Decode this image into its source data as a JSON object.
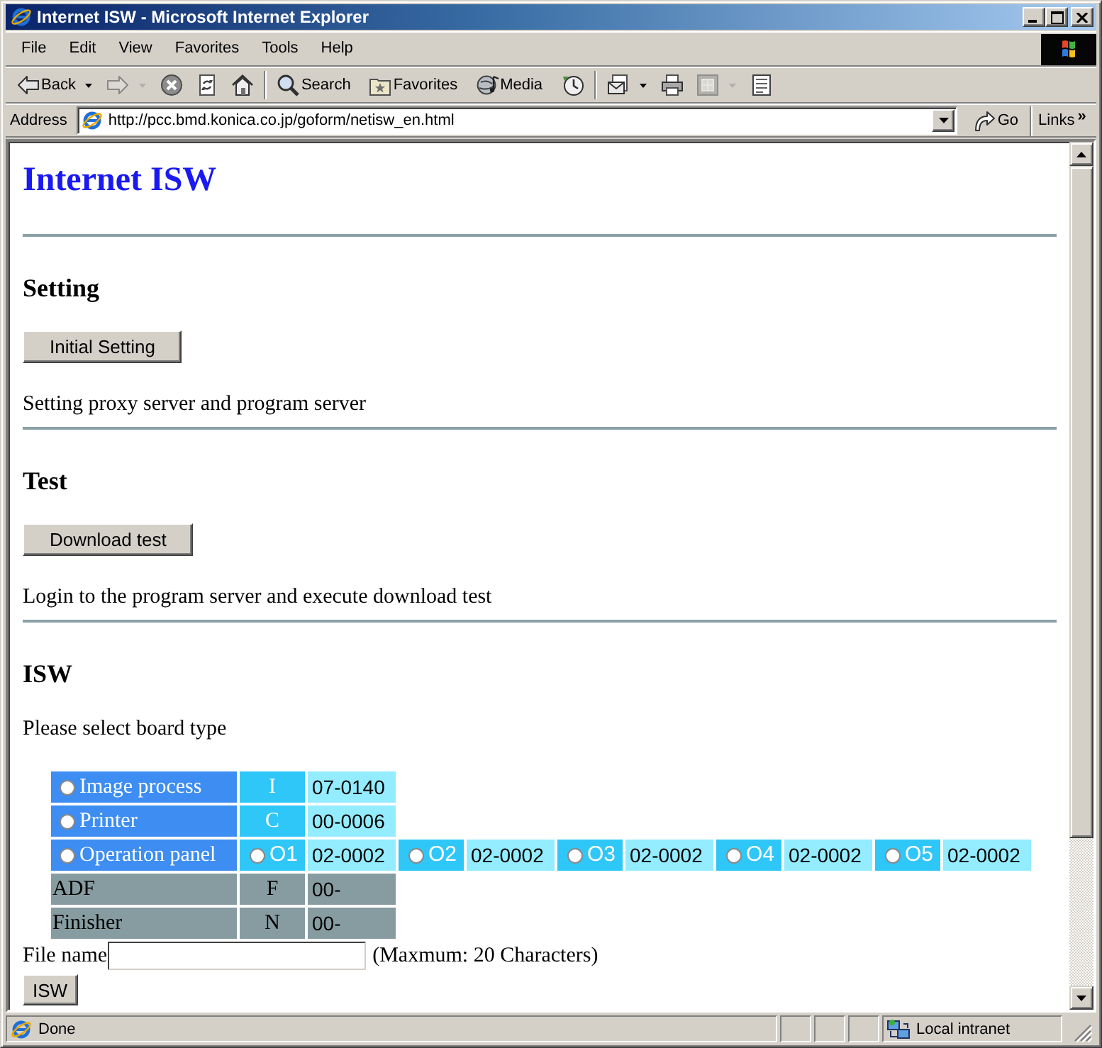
{
  "window": {
    "title": "Internet ISW - Microsoft Internet Explorer"
  },
  "menu_bar": {
    "items": [
      {
        "label": "File"
      },
      {
        "label": "Edit"
      },
      {
        "label": "View"
      },
      {
        "label": "Favorites"
      },
      {
        "label": "Tools"
      },
      {
        "label": "Help"
      }
    ]
  },
  "toolbar": {
    "groups": [
      [
        {
          "kind": "back",
          "label": "Back",
          "dropdown": true,
          "disabled": false
        },
        {
          "kind": "forward",
          "dropdown": true,
          "disabled": true
        },
        {
          "kind": "stop",
          "disabled": false
        },
        {
          "kind": "refresh",
          "disabled": false
        },
        {
          "kind": "home",
          "disabled": false
        }
      ],
      [
        {
          "kind": "search",
          "label": "Search",
          "disabled": false
        },
        {
          "kind": "favorites",
          "label": "Favorites",
          "disabled": false
        },
        {
          "kind": "media",
          "label": "Media",
          "disabled": false
        },
        {
          "kind": "history",
          "disabled": false
        }
      ],
      [
        {
          "kind": "mail",
          "dropdown": true,
          "disabled": false
        },
        {
          "kind": "print",
          "disabled": false
        },
        {
          "kind": "edit",
          "dropdown": true,
          "disabled": true
        },
        {
          "kind": "discuss",
          "disabled": false
        }
      ]
    ]
  },
  "address_bar": {
    "label": "Address",
    "value": "http://pcc.bmd.konica.co.jp/goform/netisw_en.html",
    "go": "Go",
    "links": "Links",
    "chevron": "»"
  },
  "page": {
    "title": "Internet ISW",
    "sections": [
      {
        "heading": "Setting",
        "button": "Initial Setting",
        "description": "Setting proxy server and program server"
      },
      {
        "heading": "Test",
        "button": "Download test",
        "description": "Login to the program server and execute download test"
      }
    ],
    "isw": {
      "heading": "ISW",
      "prompt": "Please select board type",
      "boards": [
        {
          "kind": "choice",
          "name": "Image process",
          "selected": false,
          "code": "I",
          "version": "07-0140"
        },
        {
          "kind": "choice",
          "name": "Printer",
          "selected": false,
          "code": "C",
          "version": "00-0006"
        },
        {
          "kind": "choice",
          "name": "Operation panel",
          "selected": false,
          "options": [
            {
              "label": "O1",
              "version": "02-0002",
              "selected": false
            },
            {
              "label": "O2",
              "version": "02-0002",
              "selected": false
            },
            {
              "label": "O3",
              "version": "02-0002",
              "selected": false
            },
            {
              "label": "O4",
              "version": "02-0002",
              "selected": false
            },
            {
              "label": "O5",
              "version": "02-0002",
              "selected": false
            }
          ]
        },
        {
          "kind": "fixed",
          "name": "ADF",
          "code": "F",
          "version": "00-"
        },
        {
          "kind": "fixed",
          "name": "Finisher",
          "code": "N",
          "version": "00-"
        }
      ],
      "file_name": {
        "label": "File name",
        "hint": "(Maxmum: 20 Characters)"
      },
      "button": "ISW"
    }
  },
  "status_bar": {
    "text": "Done",
    "zone": "Local intranet"
  }
}
